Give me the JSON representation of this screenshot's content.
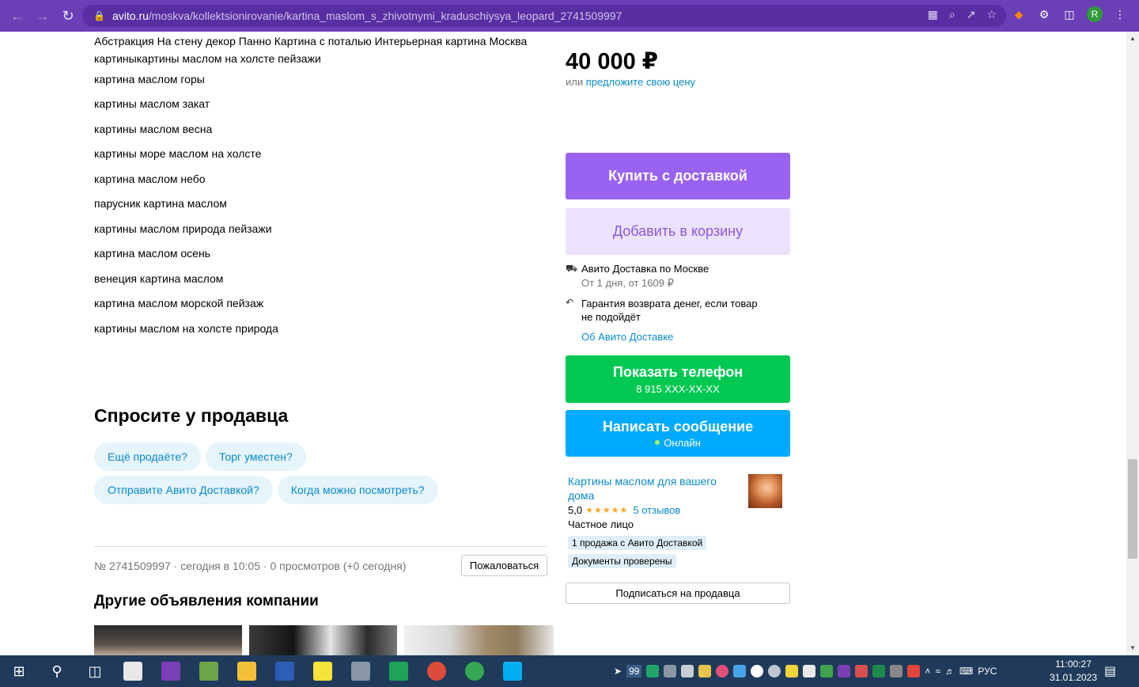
{
  "browser": {
    "url_host": "avito.ru",
    "url_path": "/moskva/kollektsionirovanie/kartina_maslom_s_zhivotnymi_kraduschiysya_leopard_2741509997",
    "profile_initial": "R"
  },
  "description": {
    "paragraph": "Абстракция На стену декор Панно Картина с поталью Интерьерная картина Москва",
    "keywords_first": "картиныкартины маслом на холсте пейзажи",
    "keywords": [
      "картина маслом горы",
      "картины маслом закат",
      "картины маслом весна",
      "картины море маслом на холсте",
      "картина маслом небо",
      "парусник картина маслом",
      "картины маслом природа пейзажи",
      "картина маслом осень",
      "венеция картина маслом",
      "картина маслом морской пейзаж",
      "картины маслом на холсте природа"
    ]
  },
  "ask_seller": {
    "title": "Спросите у продавца",
    "chips": [
      "Ещё продаёте?",
      "Торг уместен?",
      "Отправите Авито Доставкой?",
      "Когда можно посмотреть?"
    ]
  },
  "listing_meta": {
    "text": "№ 2741509997 · сегодня в 10:05 · 0 просмотров (+0 сегодня)",
    "report_label": "Пожаловаться"
  },
  "other_listings": {
    "title": "Другие объявления компании"
  },
  "purchase": {
    "price": "40 000 ₽",
    "offer_prefix": "или ",
    "offer_link": "предложите свою цену",
    "buy_label": "Купить с доставкой",
    "cart_label": "Добавить в корзину",
    "delivery_title": "Авито Доставка по Москве",
    "delivery_sub": "От 1 дня, от 1609 ₽",
    "guarantee_line1": "Гарантия возврата денег, если товар",
    "guarantee_line2": "не подойдёт",
    "about_delivery": "Об Авито Доставке",
    "phone_label": "Показать телефон",
    "phone_number": "8 915 XXX-XX-XX",
    "message_label": "Написать сообщение",
    "online_label": "Онлайн"
  },
  "seller": {
    "name": "Картины маслом для вашего дома",
    "rating": "5,0",
    "stars": "★★★★★",
    "reviews": "5 отзывов",
    "type": "Частное лицо",
    "tag1": "1 продажа с Авито Доставкой",
    "tag2": "Документы проверены",
    "subscribe_label": "Подписаться на продавца"
  },
  "taskbar": {
    "tray_badge": "99",
    "language": "РУС",
    "time": "11:00:27",
    "date": "31.01.2023"
  },
  "colors": {
    "chrome": "#6b3fb5",
    "buy": "#9a62f0",
    "cart_bg": "#ece2fd",
    "phone": "#00c853",
    "message": "#00aaff",
    "link": "#0a8ac8"
  }
}
